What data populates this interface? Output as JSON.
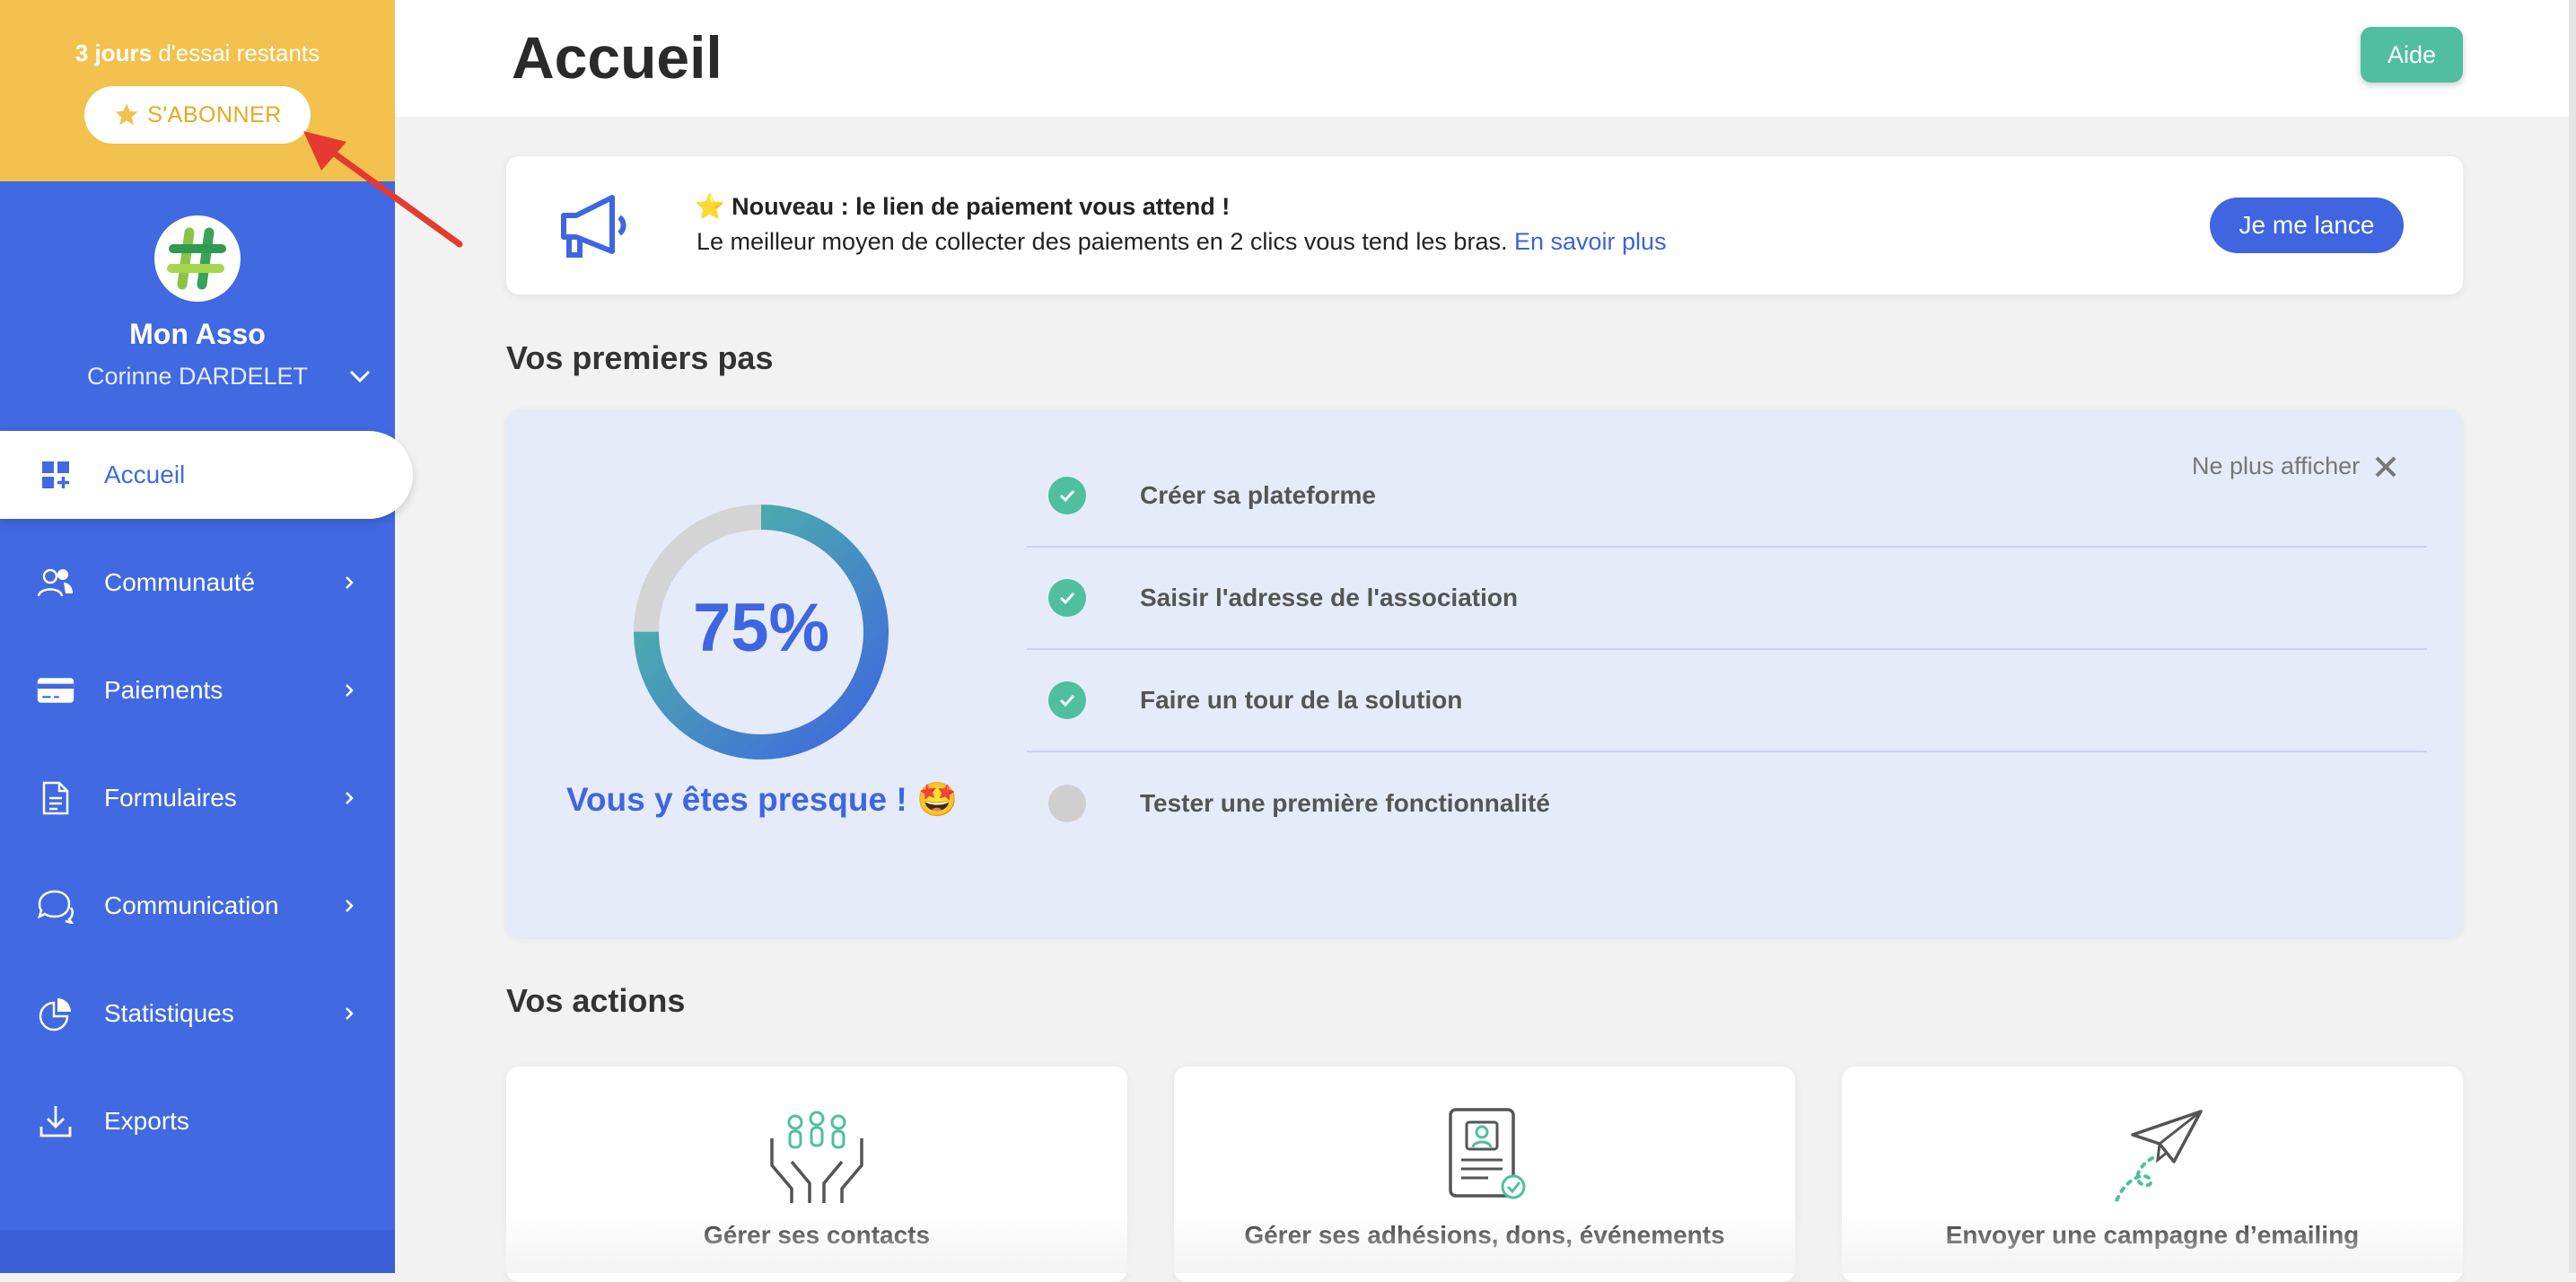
{
  "trial": {
    "days": "3 jours",
    "rest": "d'essai restants",
    "subscribe_label": "S'ABONNER"
  },
  "org": {
    "name": "Mon Asso",
    "user": "Corinne DARDELET"
  },
  "nav": [
    {
      "label": "Accueil",
      "icon": "dashboard-icon"
    },
    {
      "label": "Communauté",
      "icon": "users-icon"
    },
    {
      "label": "Paiements",
      "icon": "credit-card-icon"
    },
    {
      "label": "Formulaires",
      "icon": "document-icon"
    },
    {
      "label": "Communication",
      "icon": "chat-icon"
    },
    {
      "label": "Statistiques",
      "icon": "chart-pie-icon"
    },
    {
      "label": "Exports",
      "icon": "download-icon"
    }
  ],
  "header": {
    "title": "Accueil",
    "help_label": "Aide"
  },
  "announcement": {
    "title": "⭐ Nouveau : le lien de paiement vous attend !",
    "body": "Le meilleur moyen de collecter des paiements en 2 clics vous tend les bras.",
    "link": "En savoir plus",
    "button": "Je me lance"
  },
  "first_steps": {
    "title": "Vos premiers pas",
    "dismiss": "Ne plus afficher",
    "progress": 75,
    "progress_label": "75%",
    "message": "Vous y êtes presque ! 🤩",
    "steps": [
      {
        "label": "Créer sa plateforme",
        "done": true
      },
      {
        "label": "Saisir l'adresse de l'association",
        "done": true
      },
      {
        "label": "Faire un tour de la solution",
        "done": true
      },
      {
        "label": "Tester une première fonctionnalité",
        "done": false
      }
    ]
  },
  "actions": {
    "title": "Vos actions",
    "items": [
      {
        "label": "Gérer ses contacts",
        "icon": "hands-people-icon"
      },
      {
        "label": "Gérer ses adhésions, dons, événements",
        "icon": "membership-card-icon"
      },
      {
        "label": "Envoyer une campagne d’emailing",
        "icon": "paper-plane-icon"
      }
    ]
  },
  "colors": {
    "primary": "#4169e1",
    "accent": "#4fbf9f",
    "trial": "#f2c14e"
  }
}
